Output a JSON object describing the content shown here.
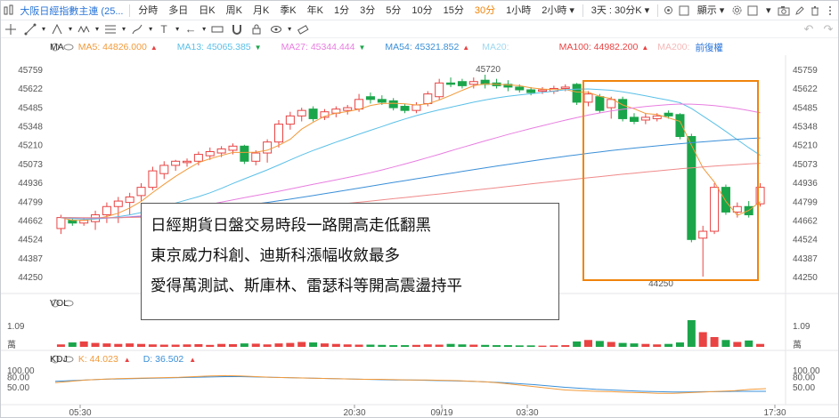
{
  "toolbar": {
    "symbol": "大阪日經指數主連 (25...",
    "intervals": [
      "分時",
      "多日",
      "日K",
      "周K",
      "月K",
      "季K",
      "年K",
      "1分",
      "3分",
      "5分",
      "10分",
      "15分",
      "30分",
      "1小時",
      "2小時"
    ],
    "active_interval": "30分",
    "range_label": "3天 : 30分K",
    "display_label": "顯示"
  },
  "legend": {
    "main_label": "MA",
    "ma5": "MA5:  44826.000",
    "ma13": "MA13:  45065.385",
    "ma27": "MA27:  45344.444",
    "ma54": "MA54:  45321.852",
    "ma20": "MA20:",
    "ma100": "MA100:  44982.200",
    "ma200": "MA200:",
    "adjust": "前復權"
  },
  "colors": {
    "up": "#e94343",
    "down": "#1aa54a",
    "ma5": "#f29a3b",
    "ma13": "#5bc0e8",
    "ma27": "#e87ee0",
    "ma54": "#3a8fd8",
    "ma100": "#f08a8a",
    "accent": "#f0840c"
  },
  "price_axis": [
    "45759",
    "45622",
    "45485",
    "45348",
    "45210",
    "45073",
    "44936",
    "44799",
    "44662",
    "44524",
    "44387",
    "44250"
  ],
  "high_label": "45720",
  "low_label": "44250",
  "annotation": {
    "line1": "日經期貨日盤交易時段一路開高走低翻黑",
    "line2": "東京威力科創、迪斯科漲幅收斂最多",
    "line3": "愛得萬測試、斯庫林、雷瑟科等開高震盪持平"
  },
  "volume": {
    "label": "VOL",
    "axis_top": "1.09",
    "axis_unit": "萬"
  },
  "kdj": {
    "label": "KDJ",
    "k": "K:  44.023",
    "d": "D:  36.502",
    "axis": [
      "100.00",
      "80.00",
      "50.00"
    ]
  },
  "time_axis": [
    "05:30",
    "20:30",
    "09/19",
    "03:30",
    "17:30"
  ],
  "chart_data": {
    "type": "candlestick",
    "ylim": [
      44250,
      45759
    ],
    "candles": [
      {
        "o": 44600,
        "c": 44680,
        "h": 44700,
        "l": 44560
      },
      {
        "o": 44660,
        "c": 44640,
        "h": 44680,
        "l": 44620
      },
      {
        "o": 44640,
        "c": 44660,
        "h": 44680,
        "l": 44620
      },
      {
        "o": 44650,
        "c": 44700,
        "h": 44730,
        "l": 44590
      },
      {
        "o": 44700,
        "c": 44760,
        "h": 44790,
        "l": 44640
      },
      {
        "o": 44760,
        "c": 44800,
        "h": 44830,
        "l": 44640
      },
      {
        "o": 44790,
        "c": 44830,
        "h": 44860,
        "l": 44700
      },
      {
        "o": 44840,
        "c": 44900,
        "h": 44930,
        "l": 44800
      },
      {
        "o": 44900,
        "c": 45020,
        "h": 45050,
        "l": 44880
      },
      {
        "o": 45000,
        "c": 45060,
        "h": 45090,
        "l": 44960
      },
      {
        "o": 45060,
        "c": 45090,
        "h": 45100,
        "l": 45020
      },
      {
        "o": 45080,
        "c": 45090,
        "h": 45110,
        "l": 45050
      },
      {
        "o": 45090,
        "c": 45140,
        "h": 45160,
        "l": 45060
      },
      {
        "o": 45130,
        "c": 45160,
        "h": 45190,
        "l": 45100
      },
      {
        "o": 45150,
        "c": 45180,
        "h": 45200,
        "l": 45120
      },
      {
        "o": 45170,
        "c": 45200,
        "h": 45220,
        "l": 45140
      },
      {
        "o": 45200,
        "c": 45090,
        "h": 45210,
        "l": 45070
      },
      {
        "o": 45090,
        "c": 45150,
        "h": 45170,
        "l": 45060
      },
      {
        "o": 45150,
        "c": 45230,
        "h": 45250,
        "l": 45080
      },
      {
        "o": 45230,
        "c": 45360,
        "h": 45390,
        "l": 45190
      },
      {
        "o": 45360,
        "c": 45420,
        "h": 45450,
        "l": 45320
      },
      {
        "o": 45420,
        "c": 45460,
        "h": 45480,
        "l": 45380
      },
      {
        "o": 45470,
        "c": 45400,
        "h": 45490,
        "l": 45380
      },
      {
        "o": 45410,
        "c": 45450,
        "h": 45470,
        "l": 45390
      },
      {
        "o": 45440,
        "c": 45470,
        "h": 45490,
        "l": 45410
      },
      {
        "o": 45460,
        "c": 45480,
        "h": 45500,
        "l": 45430
      },
      {
        "o": 45470,
        "c": 45540,
        "h": 45580,
        "l": 45450
      },
      {
        "o": 45560,
        "c": 45540,
        "h": 45590,
        "l": 45510
      },
      {
        "o": 45540,
        "c": 45520,
        "h": 45570,
        "l": 45500
      },
      {
        "o": 45530,
        "c": 45480,
        "h": 45550,
        "l": 45460
      },
      {
        "o": 45490,
        "c": 45460,
        "h": 45510,
        "l": 45440
      },
      {
        "o": 45460,
        "c": 45500,
        "h": 45520,
        "l": 45440
      },
      {
        "o": 45510,
        "c": 45580,
        "h": 45600,
        "l": 45490
      },
      {
        "o": 45560,
        "c": 45660,
        "h": 45690,
        "l": 45540
      },
      {
        "o": 45660,
        "c": 45650,
        "h": 45700,
        "l": 45630
      },
      {
        "o": 45670,
        "c": 45640,
        "h": 45690,
        "l": 45620
      },
      {
        "o": 45650,
        "c": 45670,
        "h": 45700,
        "l": 45620
      },
      {
        "o": 45680,
        "c": 45650,
        "h": 45720,
        "l": 45620
      },
      {
        "o": 45660,
        "c": 45640,
        "h": 45690,
        "l": 45620
      },
      {
        "o": 45650,
        "c": 45630,
        "h": 45680,
        "l": 45600
      },
      {
        "o": 45630,
        "c": 45610,
        "h": 45650,
        "l": 45590
      },
      {
        "o": 45610,
        "c": 45590,
        "h": 45630,
        "l": 45570
      },
      {
        "o": 45600,
        "c": 45610,
        "h": 45630,
        "l": 45580
      },
      {
        "o": 45600,
        "c": 45620,
        "h": 45640,
        "l": 45580
      },
      {
        "o": 45620,
        "c": 45630,
        "h": 45650,
        "l": 45600
      },
      {
        "o": 45650,
        "c": 45520,
        "h": 45660,
        "l": 45500
      },
      {
        "o": 45520,
        "c": 45580,
        "h": 45600,
        "l": 45490
      },
      {
        "o": 45560,
        "c": 45460,
        "h": 45580,
        "l": 45440
      },
      {
        "o": 45480,
        "c": 45540,
        "h": 45560,
        "l": 45400
      },
      {
        "o": 45540,
        "c": 45400,
        "h": 45560,
        "l": 45380
      },
      {
        "o": 45410,
        "c": 45380,
        "h": 45440,
        "l": 45360
      },
      {
        "o": 45390,
        "c": 45410,
        "h": 45440,
        "l": 45360
      },
      {
        "o": 45400,
        "c": 45420,
        "h": 45440,
        "l": 45380
      },
      {
        "o": 45440,
        "c": 45420,
        "h": 45460,
        "l": 45400
      },
      {
        "o": 45430,
        "c": 45270,
        "h": 45440,
        "l": 45250
      },
      {
        "o": 45270,
        "c": 44520,
        "h": 45290,
        "l": 44500
      },
      {
        "o": 44530,
        "c": 44580,
        "h": 44620,
        "l": 44250
      },
      {
        "o": 44580,
        "c": 44900,
        "h": 44930,
        "l": 44560
      },
      {
        "o": 44900,
        "c": 44720,
        "h": 44920,
        "l": 44700
      },
      {
        "o": 44720,
        "c": 44760,
        "h": 44790,
        "l": 44680
      },
      {
        "o": 44760,
        "c": 44700,
        "h": 44800,
        "l": 44680
      },
      {
        "o": 44780,
        "c": 44900,
        "h": 44930,
        "l": 44760
      }
    ],
    "volume": [
      10,
      18,
      22,
      16,
      14,
      12,
      14,
      12,
      10,
      9,
      9,
      10,
      11,
      8,
      12,
      11,
      14,
      13,
      10,
      14,
      16,
      20,
      18,
      14,
      12,
      10,
      9,
      9,
      8,
      7,
      7,
      8,
      10,
      9,
      12,
      10,
      9,
      8,
      7,
      7,
      6,
      6,
      5,
      6,
      7,
      22,
      28,
      24,
      20,
      16,
      14,
      12,
      10,
      12,
      18,
      109,
      60,
      40,
      28,
      20,
      26,
      12
    ],
    "kdj_k": [
      62,
      66,
      70,
      72,
      74,
      75,
      76,
      77,
      78,
      80,
      82,
      83,
      82,
      80,
      78,
      77,
      76,
      75,
      74,
      73,
      72,
      72,
      71,
      70,
      70,
      69,
      68,
      66,
      64,
      60,
      55,
      50,
      45,
      40,
      38,
      36,
      35,
      33,
      32,
      30,
      30,
      32,
      34,
      36,
      38,
      42,
      44
    ],
    "kdj_d": [
      66,
      68,
      70,
      72,
      73,
      74,
      75,
      76,
      77,
      78,
      79,
      80,
      80,
      79,
      78,
      77,
      76,
      75,
      74,
      73,
      72,
      71,
      70,
      70,
      69,
      68,
      67,
      66,
      64,
      62,
      59,
      56,
      52,
      48,
      45,
      42,
      40,
      38,
      36,
      35,
      34,
      34,
      35,
      35,
      36,
      36,
      36
    ]
  }
}
